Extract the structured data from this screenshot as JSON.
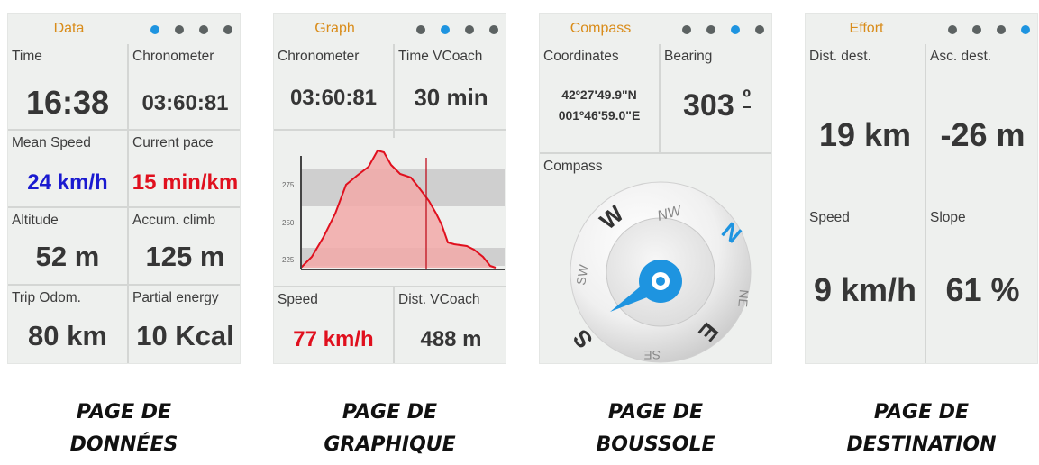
{
  "pages": [
    {
      "header": "Data",
      "active_dot": 0,
      "cells": [
        {
          "label": "Time",
          "value": "16:38",
          "color": "#333333"
        },
        {
          "label": "Chronometer",
          "value": "03:60:81",
          "color": "#333333"
        },
        {
          "label": "Mean Speed",
          "value": "24 km/h",
          "color": "#1a1ad0"
        },
        {
          "label": "Current pace",
          "value": "15 min/km",
          "color": "#e0101e"
        },
        {
          "label": "Altitude",
          "value": "52 m",
          "color": "#333333"
        },
        {
          "label": "Accum. climb",
          "value": "125 m",
          "color": "#333333"
        },
        {
          "label": "Trip Odom.",
          "value": "80 km",
          "color": "#333333"
        },
        {
          "label": "Partial energy",
          "value": "10 Kcal",
          "color": "#333333"
        }
      ],
      "caption_line1": "PAGE DE",
      "caption_line2": "DONNÉES"
    },
    {
      "header": "Graph",
      "active_dot": 1,
      "cells": [
        {
          "label": "Chronometer",
          "value": "03:60:81",
          "color": "#333333"
        },
        {
          "label": "Time VCoach",
          "value": "30 min",
          "color": "#333333"
        },
        {
          "label": "Speed",
          "value": "77 km/h",
          "color": "#e0101e"
        },
        {
          "label": "Dist. VCoach",
          "value": "488 m",
          "color": "#333333"
        }
      ],
      "graph": {
        "y_ticks": [
          "275",
          "250",
          "225"
        ]
      },
      "caption_line1": "PAGE DE",
      "caption_line2": "GRAPHIQUE"
    },
    {
      "header": "Compass",
      "active_dot": 2,
      "coord_label": "Coordinates",
      "lat": "42º27'49.9\"N",
      "lon": "001º46'59.0\"E",
      "bearing_label": "Bearing",
      "bearing_value": "303",
      "bearing_unit": "º",
      "compass_label": "Compass",
      "compass_letters": {
        "n": "N",
        "ne": "NE",
        "e": "E",
        "se": "SE",
        "s": "S",
        "sw": "SW",
        "w": "W",
        "nw": "NW"
      },
      "caption_line1": "PAGE DE",
      "caption_line2": "BOUSSOLE"
    },
    {
      "header": "Effort",
      "active_dot": 3,
      "cells": [
        {
          "label": "Dist. dest.",
          "value": "19 km",
          "color": "#333333"
        },
        {
          "label": "Asc. dest.",
          "value": "-26 m",
          "color": "#333333"
        },
        {
          "label": "Speed",
          "value": "9 km/h",
          "color": "#333333"
        },
        {
          "label": "Slope",
          "value": "61 %",
          "color": "#333333"
        }
      ],
      "caption_line1": "PAGE DE",
      "caption_line2": "DESTINATION"
    }
  ],
  "colors": {
    "accent_orange": "#d98c1a",
    "dot_active": "#1e94e0",
    "dot_inactive": "#5c6262",
    "profile_fill": "#f2a9a8",
    "profile_line": "#e0101e"
  }
}
